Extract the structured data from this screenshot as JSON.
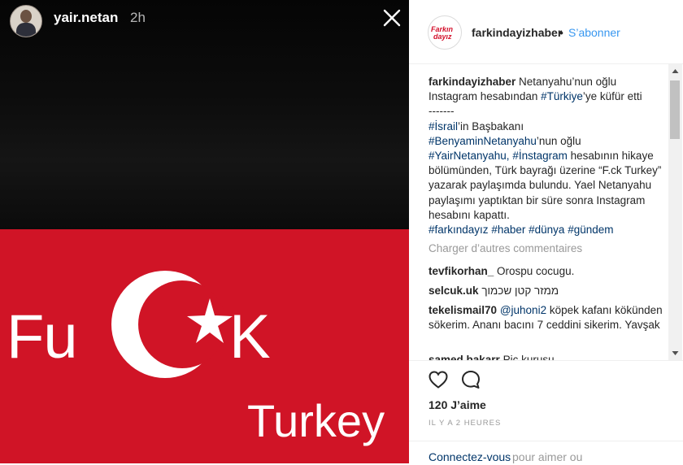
{
  "story": {
    "username": "yair.netan",
    "time": "2h",
    "image_text": {
      "left": "Fu",
      "right": "K",
      "bottom": "Turkey"
    }
  },
  "post": {
    "account": "farkindayizhaber",
    "separator": "•",
    "follow_label": "S’abonner",
    "logo_text_1": "Farkın",
    "logo_text_2": "dayız",
    "caption": {
      "username": "farkindayizhaber",
      "part1": " Netanyahu’nun oğlu Instagram hesabından ",
      "tag_turkiye": "#Türkiye",
      "part2": "’ye küfür etti",
      "dashes": "-------",
      "tag_israil": "#İsrail",
      "part3": "’in Başbakanı",
      "tag_benyamin": "#BenyaminNetanyahu",
      "part4": "’nun oğlu",
      "tag_yair": "#YairNetanyahu,",
      "space": " ",
      "tag_instagram": "#İnstagram",
      "part5": " hesabının hikaye bölümünden, Türk bayrağı üzerine “F.ck Turkey” yazarak paylaşımda bulundu. Yael Netanyahu paylaşımı yaptıktan bir süre sonra Instagram hesabını kapattı.",
      "tag_farkindayiz": "#farkındayız",
      "tag_haber": "#haber",
      "tag_dunya": "#dünya",
      "tag_gundem": "#gündem"
    },
    "load_more": "Charger d’autres commentaires",
    "comments": [
      {
        "user": "tevfikorhan_",
        "text": " Orospu cocugu."
      },
      {
        "user": "selcuk.uk",
        "text": " ממזר קטן שכמוך"
      },
      {
        "user": "tekelismail70",
        "mention": "@juhoni2",
        "text": " köpek kafanı kökünden sökerim. Ananı bacını 7 ceddini sikerim. Yavşak"
      },
      {
        "user": "samed.bakarr",
        "text": " Piç kurusu"
      }
    ],
    "likes": "120 J’aime",
    "posted": "IL Y A 2 HEURES",
    "login_link": "Connectez-vous",
    "login_rest": " pour aimer ou"
  },
  "colors": {
    "flag_red": "#d01426",
    "link_blue": "#3897f0",
    "hashtag": "#003569",
    "muted": "#999999"
  }
}
